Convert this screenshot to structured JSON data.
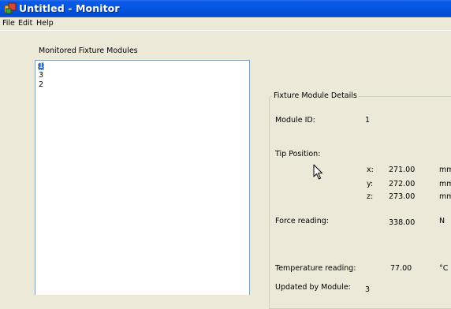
{
  "window": {
    "title": "Untitled - Monitor",
    "title_bar_color": "#0a5ae6"
  },
  "menu": {
    "items": [
      "File",
      "Edit",
      "Help"
    ]
  },
  "modules_list": {
    "label": "Monitored Fixture Modules",
    "items": [
      "1",
      "3",
      "2"
    ],
    "selected_index": 0,
    "selection_color": "#316ac5"
  },
  "details": {
    "group_title": "Fixture Module Details",
    "module_id_label": "Module ID:",
    "module_id_value": "1",
    "tip_position_label": "Tip Position:",
    "x_label": "x:",
    "x_value": "271.00",
    "x_unit": "mm",
    "y_label": "y:",
    "y_value": "272.00",
    "y_unit": "mm",
    "z_label": "z:",
    "z_value": "273.00",
    "z_unit": "mm",
    "force_label": "Force reading:",
    "force_value": "338.00",
    "force_unit": "N",
    "temperature_label": "Temperature reading:",
    "temperature_value": "77.00",
    "temperature_unit": "°C",
    "updated_by_label": "Updated by Module:",
    "updated_by_value": "3"
  }
}
